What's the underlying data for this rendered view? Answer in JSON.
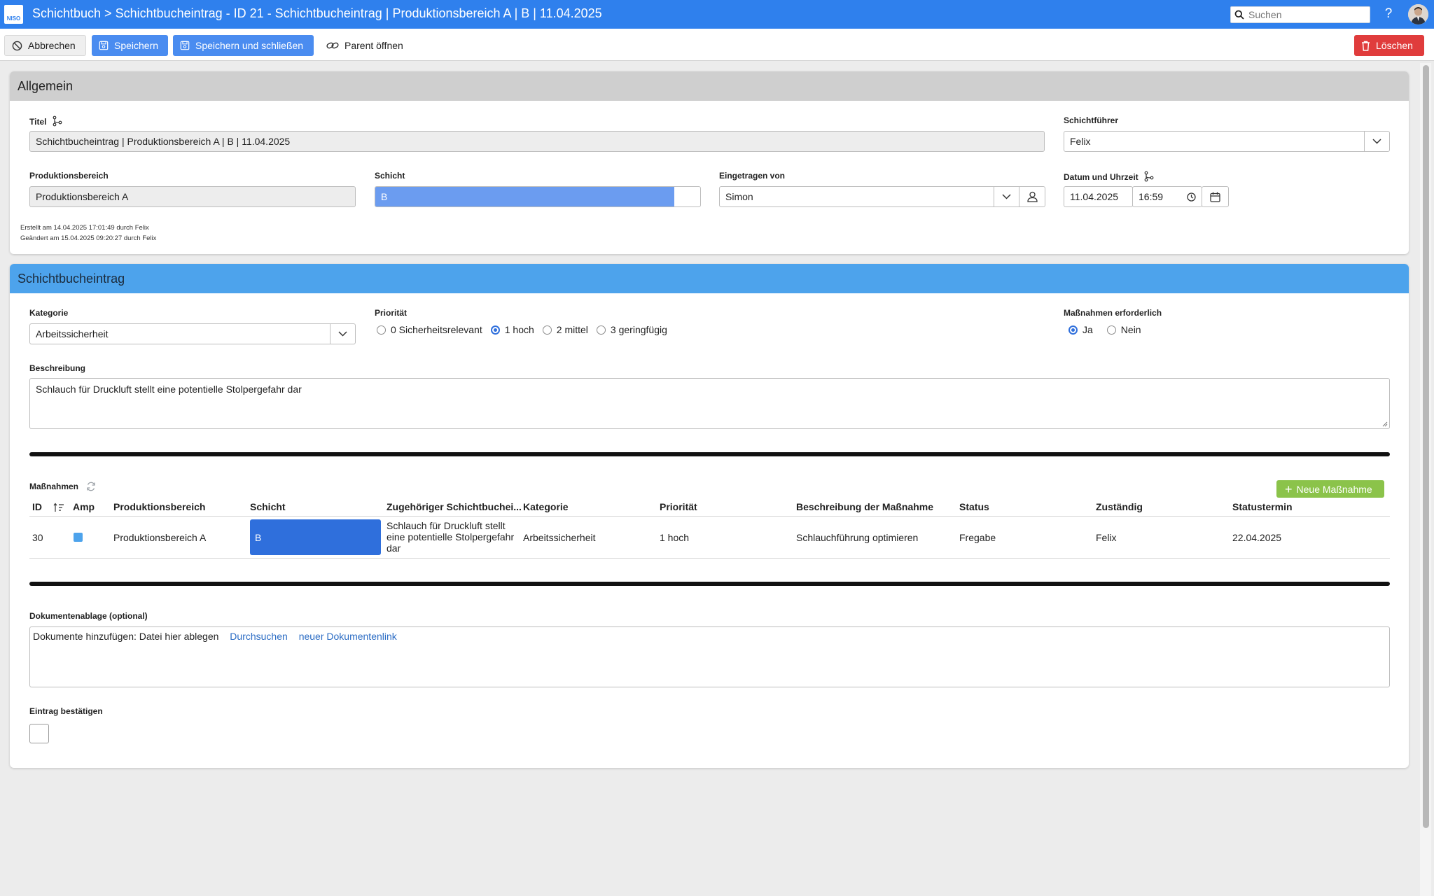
{
  "window": {
    "logo_text": "NISO",
    "breadcrumb": "Schichtbuch > Schichtbucheintrag - ID 21 - Schichtbucheintrag | Produktionsbereich A | B | 11.04.2025",
    "search_placeholder": "Suchen",
    "help_label": "?"
  },
  "toolbar": {
    "cancel": "Abbrechen",
    "save": "Speichern",
    "save_close": "Speichern und schließen",
    "open_parent": "Parent öffnen",
    "delete": "Löschen"
  },
  "general": {
    "heading": "Allgemein",
    "title_label": "Titel",
    "title_value": "Schichtbucheintrag | Produktionsbereich A | B | 11.04.2025",
    "shift_lead_label": "Schichtführer",
    "shift_lead_value": "Felix",
    "area_label": "Produktionsbereich",
    "area_value": "Produktionsbereich A",
    "shift_label": "Schicht",
    "shift_value": "B",
    "shift_color": "#6b9cf0",
    "entered_by_label": "Eingetragen von",
    "entered_by_value": "Simon",
    "datetime_label": "Datum und Uhrzeit",
    "date_value": "11.04.2025",
    "time_value": "16:59",
    "created": "Erstellt am 14.04.2025 17:01:49 durch Felix",
    "changed": "Geändert am 15.04.2025 09:20:27 durch Felix"
  },
  "entry": {
    "heading": "Schichtbucheintrag",
    "category_label": "Kategorie",
    "category_value": "Arbeitssicherheit",
    "priority_label": "Priorität",
    "priority_options": [
      "0 Sicherheitsrelevant",
      "1 hoch",
      "2 mittel",
      "3 geringfügig"
    ],
    "priority_selected": "1 hoch",
    "measures_required_label": "Maßnahmen erforderlich",
    "measures_required_options": [
      "Ja",
      "Nein"
    ],
    "measures_required_selected": "Ja",
    "description_label": "Beschreibung",
    "description_value": "Schlauch für Druckluft stellt eine potentielle Stolpergefahr dar"
  },
  "measures": {
    "label": "Maßnahmen",
    "new_button": "Neue Maßnahme",
    "columns": [
      "ID",
      "Amp",
      "Produktionsbereich",
      "Schicht",
      "Zugehöriger Schichtbuchei...",
      "Kategorie",
      "Priorität",
      "Beschreibung der Maßnahme",
      "Status",
      "Zuständig",
      "Statustermin"
    ],
    "rows": [
      {
        "id": "30",
        "amp_color": "#4da3ec",
        "area": "Produktionsbereich A",
        "shift": "B",
        "shift_color": "#2f6fdc",
        "entry_line1": "Schlauch für Druckluft stellt",
        "entry_line2": "eine potentielle Stolpergefahr",
        "entry_line3": "dar",
        "category": "Arbeitssicherheit",
        "priority": "1 hoch",
        "measure": "Schlauchführung optimieren",
        "status": "Fregabe",
        "responsible": "Felix",
        "due": "22.04.2025"
      }
    ]
  },
  "documents": {
    "label": "Dokumentenablage (optional)",
    "drop_text": "Dokumente hinzufügen: Datei hier ablegen",
    "browse": "Durchsuchen",
    "new_link": "neuer Dokumentenlink"
  },
  "confirm": {
    "label": "Eintrag bestätigen",
    "checked": false
  },
  "colors": {
    "accent": "#2f80ed",
    "primary_button": "#4a8cf0",
    "danger": "#e03c3c",
    "success": "#8bc34a",
    "section_head": "#4da3ec"
  }
}
